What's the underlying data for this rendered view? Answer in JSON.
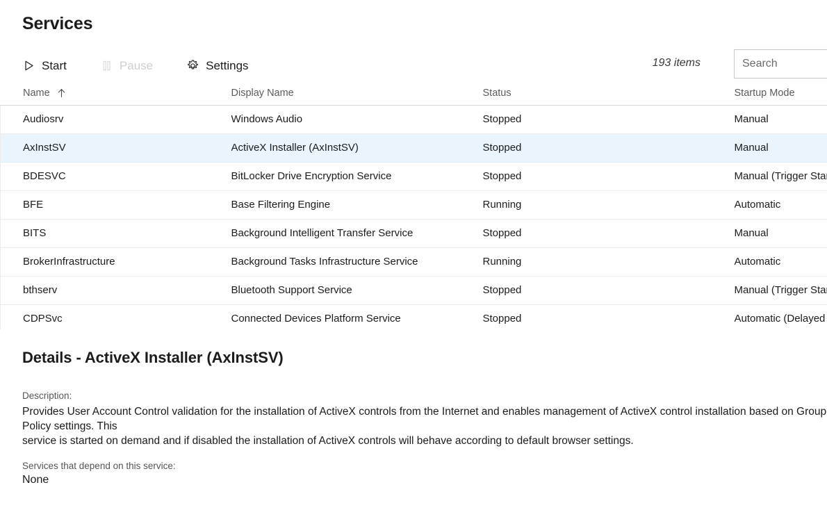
{
  "header": {
    "title": "Services"
  },
  "toolbar": {
    "buttons": [
      {
        "label": "Start",
        "icon": "play-icon",
        "disabled": false
      },
      {
        "label": "Pause",
        "icon": "pause-icon",
        "disabled": true
      },
      {
        "label": "Settings",
        "icon": "gear-icon",
        "disabled": false
      }
    ],
    "items_count": "193 items",
    "search_placeholder": "Search",
    "search_value": ""
  },
  "table": {
    "columns": [
      "Name",
      "Display Name",
      "Status",
      "Startup Mode"
    ],
    "sort": {
      "column": "Name",
      "direction": "ascending",
      "indicator": "up-arrow-icon"
    },
    "selected_index": 1,
    "rows": [
      {
        "name": "Audiosrv",
        "display_name": "Windows Audio",
        "status": "Stopped",
        "startup_mode": "Manual"
      },
      {
        "name": "AxInstSV",
        "display_name": "ActiveX Installer (AxInstSV)",
        "status": "Stopped",
        "startup_mode": "Manual"
      },
      {
        "name": "BDESVC",
        "display_name": "BitLocker Drive Encryption Service",
        "status": "Stopped",
        "startup_mode": "Manual (Trigger Start)"
      },
      {
        "name": "BFE",
        "display_name": "Base Filtering Engine",
        "status": "Running",
        "startup_mode": "Automatic"
      },
      {
        "name": "BITS",
        "display_name": "Background Intelligent Transfer Service",
        "status": "Stopped",
        "startup_mode": "Manual"
      },
      {
        "name": "BrokerInfrastructure",
        "display_name": "Background Tasks Infrastructure Service",
        "status": "Running",
        "startup_mode": "Automatic"
      },
      {
        "name": "bthserv",
        "display_name": "Bluetooth Support Service",
        "status": "Stopped",
        "startup_mode": "Manual (Trigger Start)"
      },
      {
        "name": "CDPSvc",
        "display_name": "Connected Devices Platform Service",
        "status": "Stopped",
        "startup_mode": "Automatic (Delayed Start)"
      }
    ]
  },
  "details": {
    "title": "Details - ActiveX Installer (AxInstSV)",
    "description_label": "Description:",
    "description": "Provides User Account Control validation for the installation of ActiveX controls from the Internet and enables management of ActiveX control installation based on Group Policy settings. This\nservice is started on demand and if disabled the installation of ActiveX controls will behave according to default browser settings.",
    "dependents_label": "Services that depend on this service:",
    "dependents_value": "None"
  },
  "colors": {
    "selection": "#eaf4fc",
    "text": "#1b1b1b",
    "muted": "#5a5a5a",
    "disabled": "#cfcfcf",
    "border": "#d6d6d6"
  }
}
